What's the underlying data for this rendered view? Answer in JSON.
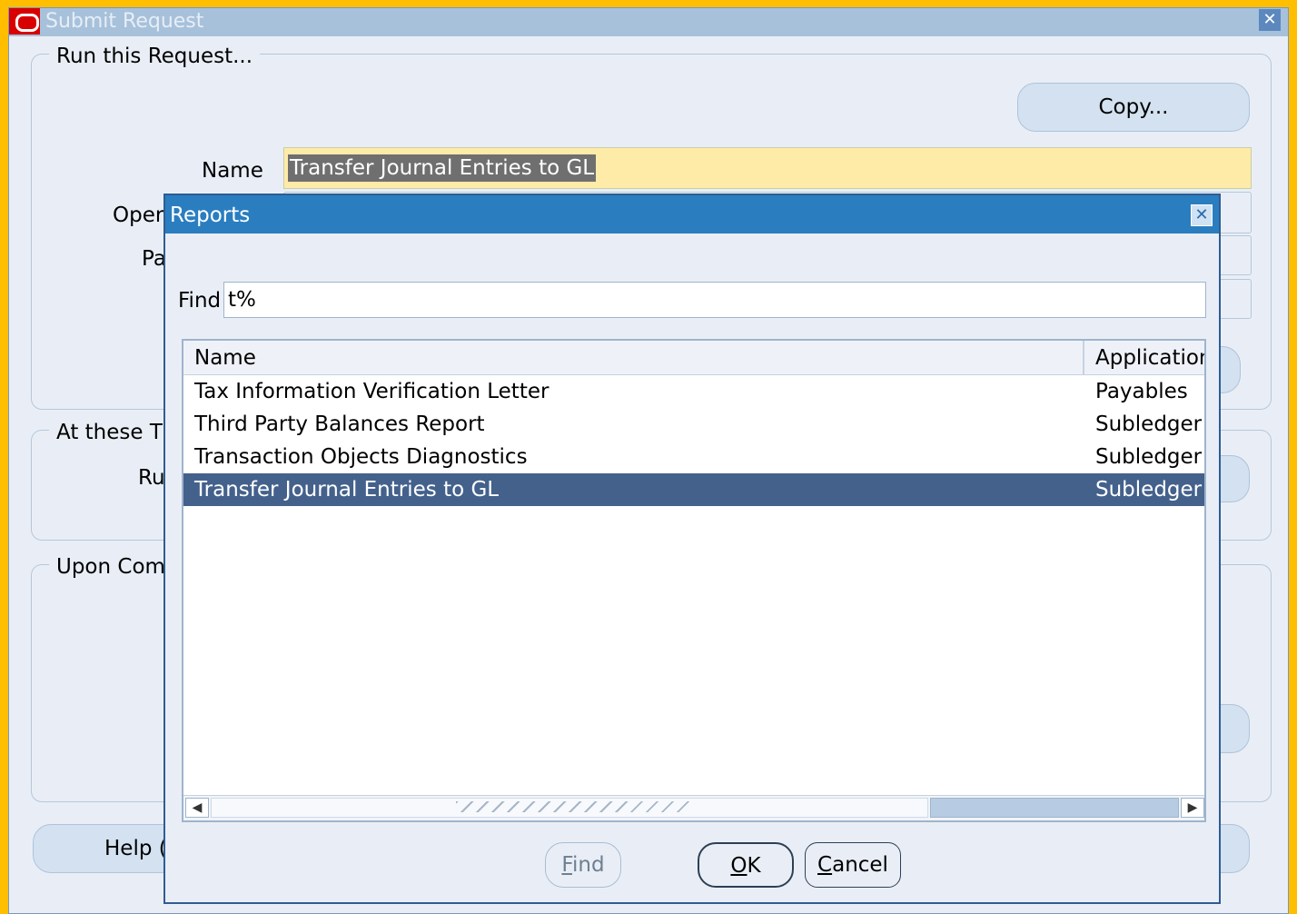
{
  "window": {
    "title": "Submit Request",
    "close": "✕"
  },
  "run_group": {
    "label": "Run this Request...",
    "copy_button": "Copy...",
    "name_label": "Name",
    "name_value": "Transfer Journal Entries to GL",
    "operating_label_partial": "Oper",
    "parameters_label_partial": "Pa"
  },
  "schedule_group": {
    "label_partial": "At these T",
    "run_label_partial": "Ru"
  },
  "completion_group": {
    "label_partial": "Upon Com"
  },
  "help_button_partial": "Help (",
  "modal": {
    "title": "Reports",
    "close": "✕",
    "find_label": "Find",
    "find_value": "t%",
    "columns": [
      "Name",
      "Application"
    ],
    "rows": [
      {
        "name": "Tax Information Verification Letter",
        "application": "Payables"
      },
      {
        "name": "Third Party Balances Report",
        "application": "Subledger"
      },
      {
        "name": "Transaction Objects Diagnostics",
        "application": "Subledger"
      },
      {
        "name": "Transfer Journal Entries to GL",
        "application": "Subledger"
      }
    ],
    "selected_row": 3,
    "buttons": {
      "find_rest": "ind",
      "find_key": "F",
      "ok_key": "O",
      "ok_rest": "K",
      "cancel_key": "C",
      "cancel_rest": "ancel"
    },
    "scroll_left": "◀",
    "scroll_right": "▶"
  }
}
